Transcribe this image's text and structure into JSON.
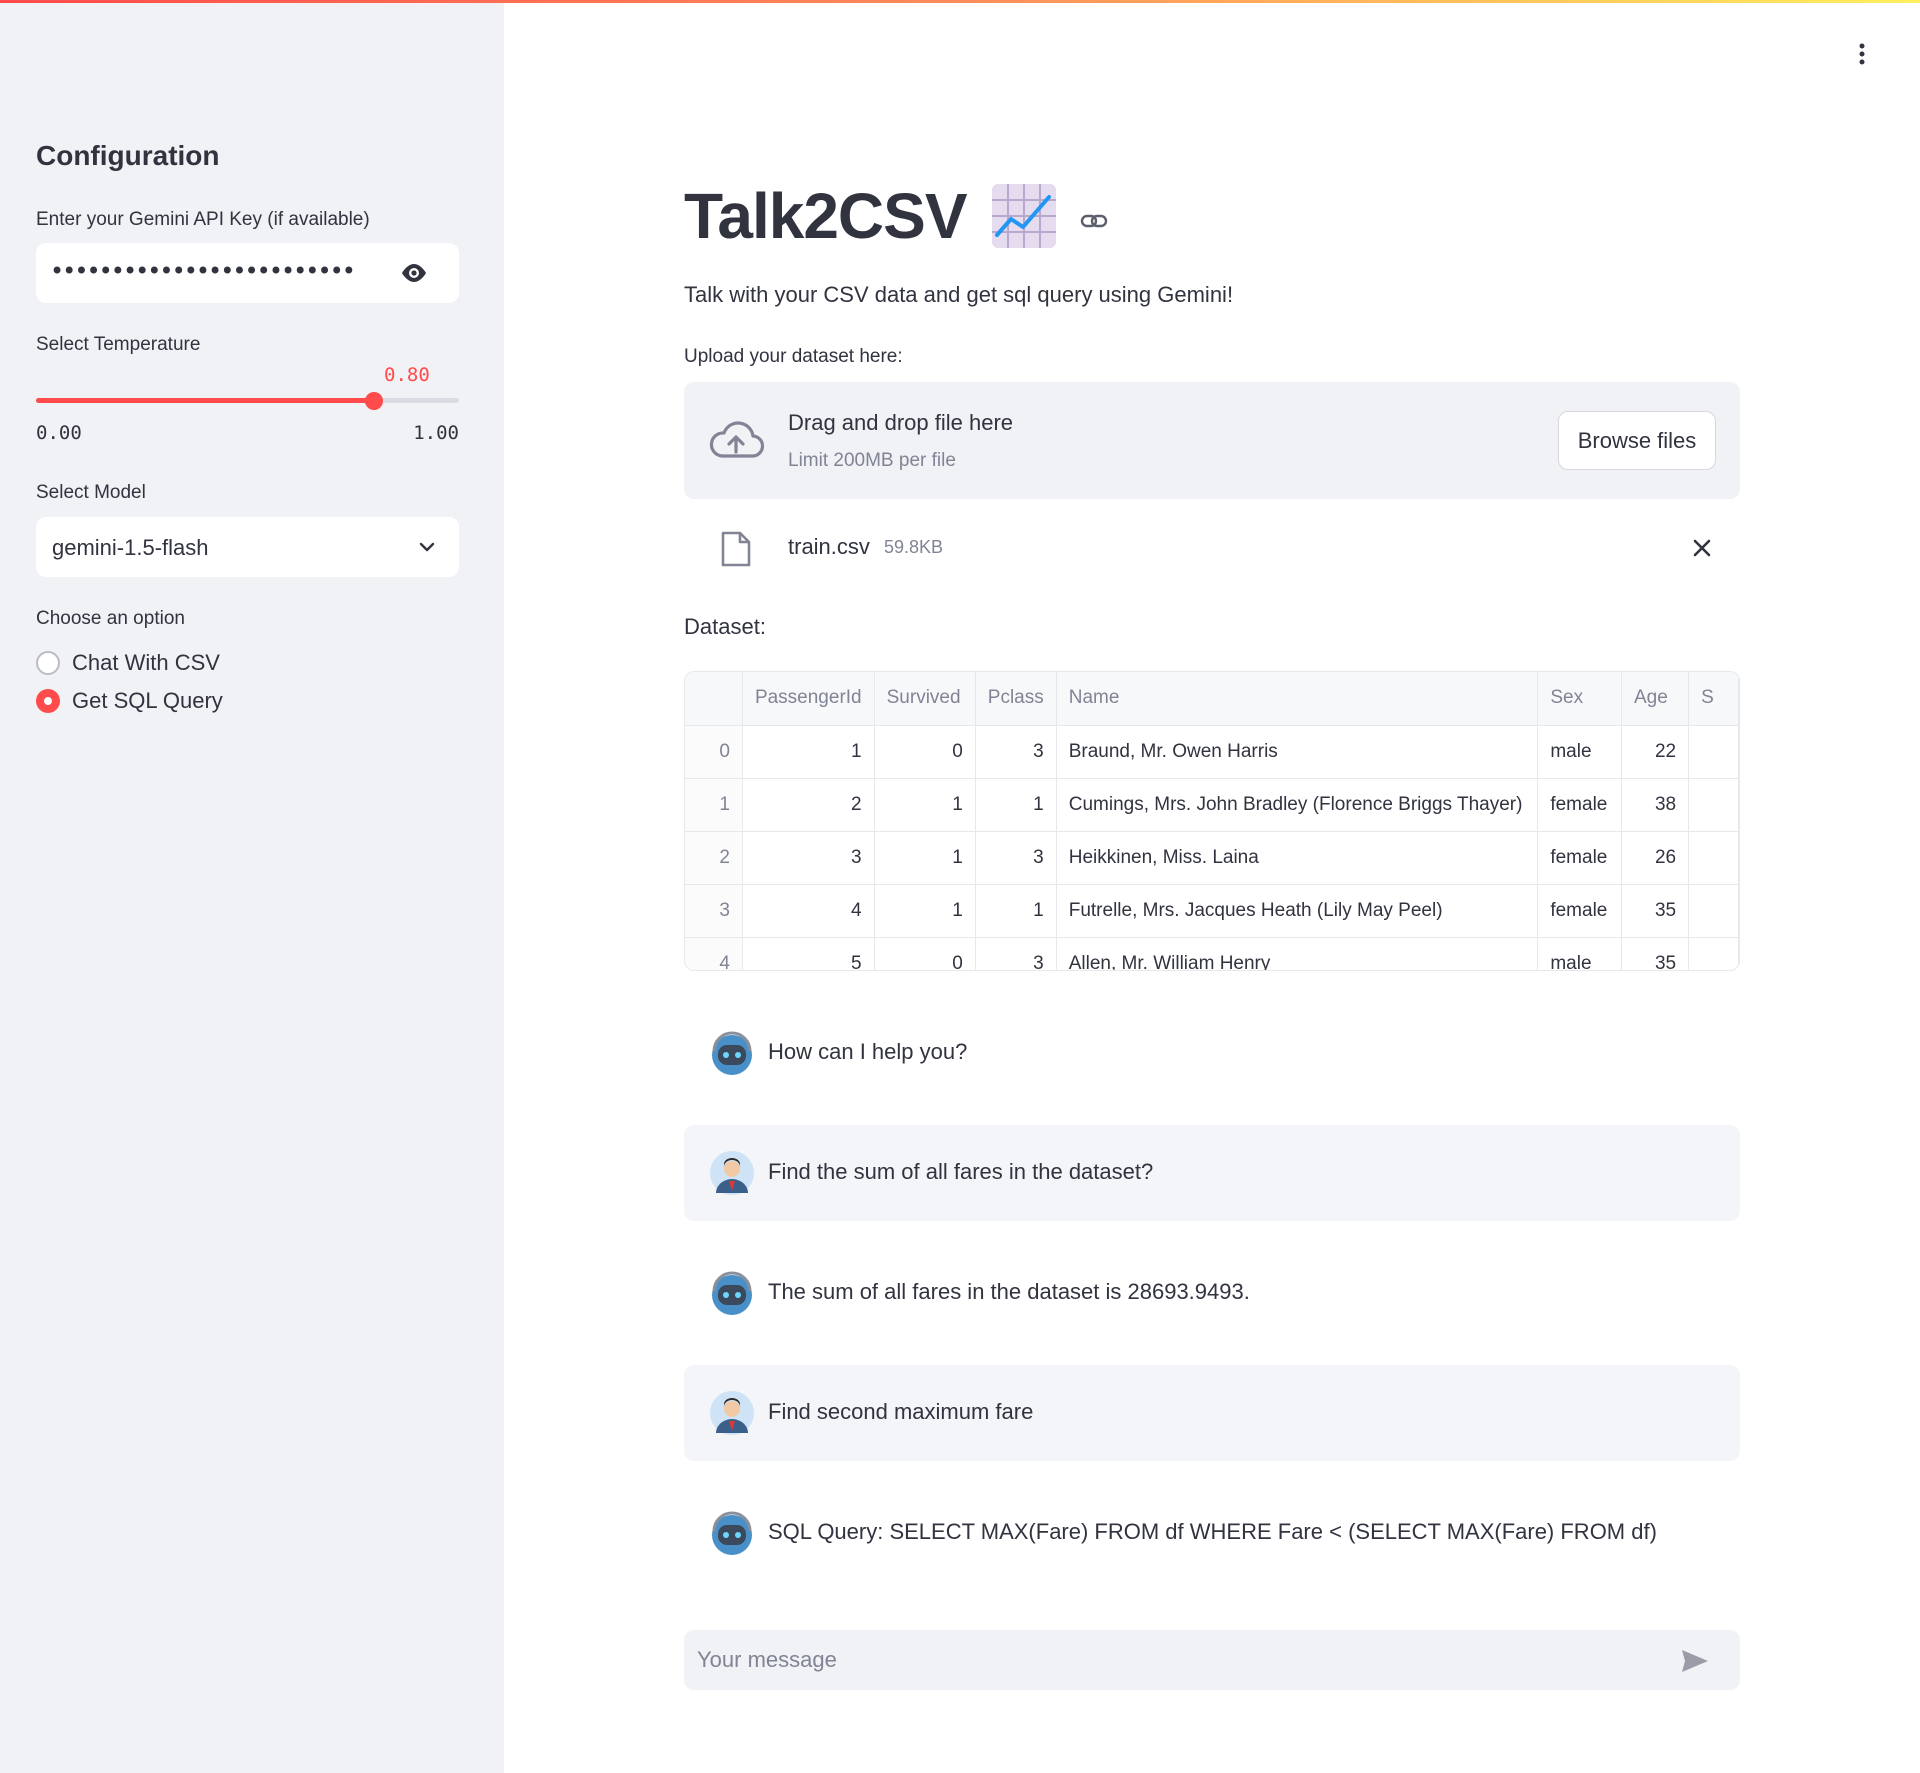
{
  "sidebar": {
    "title": "Configuration",
    "api_key_label": "Enter your Gemini API Key (if available)",
    "api_key_masked": "•••••••••••••••••••••••••",
    "temperature_label": "Select Temperature",
    "temperature_value": "0.80",
    "temperature_fraction": 0.8,
    "temperature_min": "0.00",
    "temperature_max": "1.00",
    "model_label": "Select Model",
    "model_value": "gemini-1.5-flash",
    "option_label": "Choose an option",
    "options": [
      {
        "label": "Chat With CSV",
        "selected": false
      },
      {
        "label": "Get SQL Query",
        "selected": true
      }
    ]
  },
  "main": {
    "title": "Talk2CSV",
    "title_emoji": "chart-increasing-icon",
    "subtitle": "Talk with your CSV data and get sql query using Gemini!",
    "upload_label": "Upload your dataset here:",
    "dropzone": {
      "main_text": "Drag and drop file here",
      "sub_text": "Limit 200MB per file",
      "browse_label": "Browse files"
    },
    "file": {
      "name": "train.csv",
      "size": "59.8KB"
    },
    "dataset_label": "Dataset:",
    "table": {
      "columns": [
        "",
        "PassengerId",
        "Survived",
        "Pclass",
        "Name",
        "Sex",
        "Age",
        "S"
      ],
      "rows": [
        [
          "0",
          "1",
          "0",
          "3",
          "Braund, Mr. Owen Harris",
          "male",
          "22"
        ],
        [
          "1",
          "2",
          "1",
          "1",
          "Cumings, Mrs. John Bradley (Florence Briggs Thayer)",
          "female",
          "38"
        ],
        [
          "2",
          "3",
          "1",
          "3",
          "Heikkinen, Miss. Laina",
          "female",
          "26"
        ],
        [
          "3",
          "4",
          "1",
          "1",
          "Futrelle, Mrs. Jacques Heath (Lily May Peel)",
          "female",
          "35"
        ],
        [
          "4",
          "5",
          "0",
          "3",
          "Allen, Mr. William Henry",
          "male",
          "35"
        ]
      ]
    },
    "messages": [
      {
        "role": "assistant",
        "text": "How can I help you?"
      },
      {
        "role": "user",
        "text": "Find the sum of all fares in the dataset?"
      },
      {
        "role": "assistant",
        "text": "The sum of all fares in the dataset is 28693.9493."
      },
      {
        "role": "user",
        "text": "Find second maximum fare"
      },
      {
        "role": "assistant",
        "text": "SQL Query: SELECT MAX(Fare) FROM df WHERE Fare < (SELECT MAX(Fare) FROM df)"
      }
    ],
    "chat_placeholder": "Your message"
  },
  "colors": {
    "accent": "#ff4b4b",
    "sidebar_bg": "#f0f2f6",
    "text": "#31333f",
    "muted": "#808495"
  }
}
